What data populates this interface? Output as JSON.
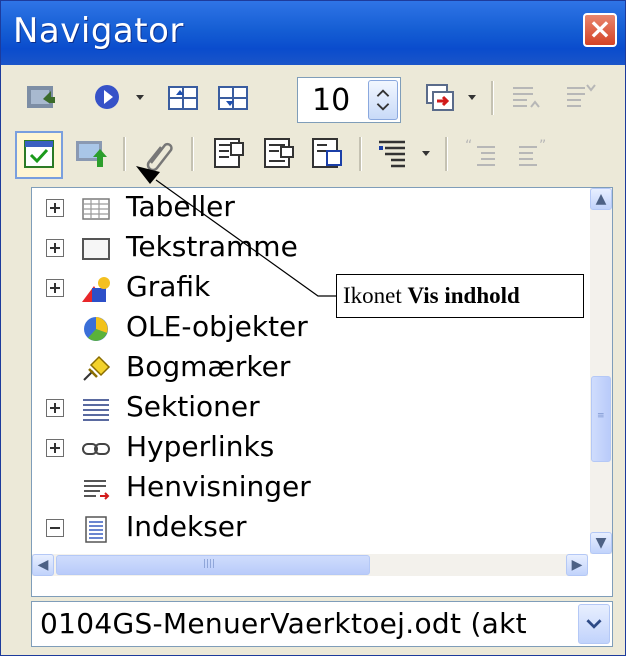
{
  "window": {
    "title": "Navigator"
  },
  "toolbar": {
    "row1": [
      {
        "name": "toggle-icon"
      },
      {
        "name": "navigation-icon"
      },
      {
        "name": "previous-icon"
      },
      {
        "name": "next-icon"
      },
      {
        "name": "drag-mode-icon"
      },
      {
        "name": "promote-level-icon"
      },
      {
        "name": "demote-level-icon"
      }
    ],
    "spin_value": "10",
    "row2": [
      {
        "name": "content-view-icon"
      },
      {
        "name": "set-reminder-icon"
      },
      {
        "name": "edit-icon"
      },
      {
        "name": "header-icon"
      },
      {
        "name": "footer-icon"
      },
      {
        "name": "anchor-icon"
      },
      {
        "name": "heading-levels-icon"
      },
      {
        "name": "promote-chapter-icon"
      },
      {
        "name": "demote-chapter-icon"
      }
    ]
  },
  "tree": {
    "items": [
      {
        "label": "Tabeller",
        "icon": "table-icon",
        "expander": "plus"
      },
      {
        "label": "Tekstramme",
        "icon": "frame-icon",
        "expander": "plus"
      },
      {
        "label": "Grafik",
        "icon": "graphics-icon",
        "expander": "plus"
      },
      {
        "label": "OLE-objekter",
        "icon": "ole-object-icon",
        "expander": "none"
      },
      {
        "label": "Bogmærker",
        "icon": "bookmark-icon",
        "expander": "none"
      },
      {
        "label": "Sektioner",
        "icon": "section-icon",
        "expander": "plus"
      },
      {
        "label": "Hyperlinks",
        "icon": "hyperlink-icon",
        "expander": "plus"
      },
      {
        "label": "Henvisninger",
        "icon": "reference-icon",
        "expander": "none"
      },
      {
        "label": "Indekser",
        "icon": "index-icon",
        "expander": "minus"
      }
    ]
  },
  "document_selector": {
    "value": "0104GS-MenuerVaerktoej.odt (akt"
  },
  "callout": {
    "prefix": "Ikonet ",
    "bold": "Vis indhold"
  },
  "colors": {
    "title_bar": "#0a4ccd",
    "close_button": "#d44326",
    "window_bg": "#ece9d8"
  }
}
